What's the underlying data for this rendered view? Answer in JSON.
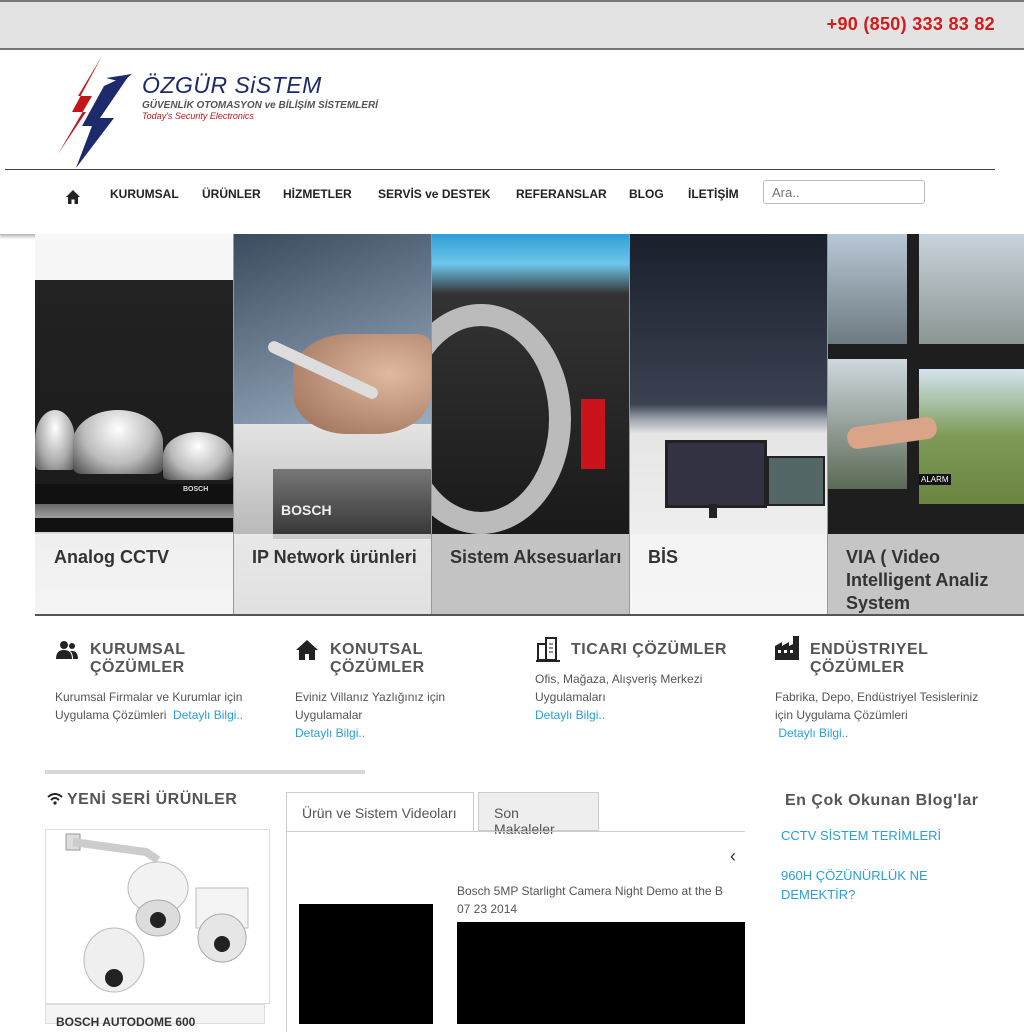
{
  "topbar": {
    "phone": "+90 (850) 333 83 82"
  },
  "brand": {
    "name": "ÖZGÜR SiSTEM",
    "tagline": "GÜVENLİK OTOMASYON ve BİLİŞİM SİSTEMLERİ",
    "slogan": "Today's Security Electronics"
  },
  "nav": {
    "items": [
      "KURUMSAL",
      "ÜRÜNLER",
      "HİZMETLER",
      "SERVİS ve DESTEK",
      "REFERANSLAR",
      "BLOG",
      "İLETİŞİM"
    ],
    "search_placeholder": "Ara.."
  },
  "slider": {
    "panels": [
      {
        "label": "Analog CCTV"
      },
      {
        "label": "IP Network ürünleri"
      },
      {
        "label": "Sistem Aksesuarları"
      },
      {
        "label": "BİS"
      },
      {
        "label": "VIA ( Video Intelligent Analiz System"
      }
    ],
    "brand_text": "BOSCH",
    "alarm_text": "ALARM"
  },
  "solutions": [
    {
      "icon": "users-icon",
      "title": "KURUMSAL ÇÖZÜMLER",
      "text": "Kurumsal Firmalar ve Kurumlar için Uygulama Çözümleri",
      "link": "Detaylı Bilgi.."
    },
    {
      "icon": "home-icon",
      "title": "KONUTSAL ÇÖZÜMLER",
      "text": "Eviniz Villanız Yazlığınız için Uygulamalar",
      "link": "Detaylı Bilgi.."
    },
    {
      "icon": "buildings-icon",
      "title": "TICARI ÇÖZÜMLER",
      "text": "Ofis, Mağaza, Alışveriş Merkezi Uygulamaları",
      "link": "Detaylı Bilgi.."
    },
    {
      "icon": "factory-icon",
      "title": "ENDÜSTRIYEL ÇÖZÜMLER",
      "text": "Fabrika, Depo, Endüstriyel Tesisleriniz için Uygulama Çözümleri",
      "link": "Detaylı Bilgi.."
    }
  ],
  "new_products": {
    "title": "YENİ SERİ ÜRÜNLER",
    "item_name": "BOSCH AUTODOME 600"
  },
  "tabs": {
    "items": [
      "Ürün ve Sistem Videoları",
      "Son Makaleler"
    ],
    "video_title": "Bosch 5MP Starlight Camera Night Demo at the B",
    "video_date": "07 23 2014"
  },
  "blog": {
    "title": "En Çok Okunan Blog'lar",
    "links": [
      "CCTV SİSTEM TERİMLERİ",
      "960H ÇÖZÜNÜRLÜK NE DEMEKTİR?"
    ]
  },
  "colors": {
    "accent": "#d31b1b",
    "link": "#2a9fd6",
    "brand": "#1d2a6b"
  }
}
